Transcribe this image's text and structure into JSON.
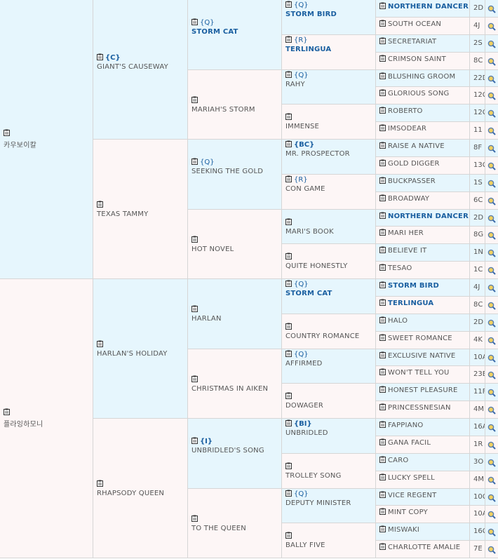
{
  "gen1": [
    {
      "name": "카우보이칼"
    },
    {
      "name": "플라잉하모니"
    }
  ],
  "gen2": [
    {
      "tag": "{C}",
      "name": "GIANT'S CAUSEWAY"
    },
    {
      "name": "TEXAS TAMMY"
    },
    {
      "name": "HARLAN'S HOLIDAY"
    },
    {
      "name": "RHAPSODY QUEEN"
    }
  ],
  "gen3": [
    {
      "tag": "{Q}",
      "name": "STORM CAT",
      "bold": true
    },
    {
      "name": "MARIAH'S STORM"
    },
    {
      "tag": "{Q}",
      "name": "SEEKING THE GOLD"
    },
    {
      "name": "HOT NOVEL"
    },
    {
      "name": "HARLAN"
    },
    {
      "name": "CHRISTMAS IN AIKEN"
    },
    {
      "tag": "{I}",
      "name": "UNBRIDLED'S SONG"
    },
    {
      "name": "TO THE QUEEN"
    }
  ],
  "gen4": [
    {
      "tag": "{Q}",
      "name": "STORM BIRD",
      "bold": true
    },
    {
      "tag": "{R}",
      "name": "TERLINGUA",
      "bold": true
    },
    {
      "tag": "{Q}",
      "name": "RAHY"
    },
    {
      "name": "IMMENSE"
    },
    {
      "tag": "{BC}",
      "name": "MR. PROSPECTOR"
    },
    {
      "tag": "{R}",
      "name": "CON GAME"
    },
    {
      "name": "MARI'S BOOK"
    },
    {
      "name": "QUITE HONESTLY"
    },
    {
      "tag": "{Q}",
      "name": "STORM CAT",
      "bold": true
    },
    {
      "name": "COUNTRY ROMANCE"
    },
    {
      "tag": "{Q}",
      "name": "AFFIRMED"
    },
    {
      "name": "DOWAGER"
    },
    {
      "tag": "{BI}",
      "name": "UNBRIDLED"
    },
    {
      "name": "TROLLEY SONG"
    },
    {
      "tag": "{Q}",
      "name": "DEPUTY MINISTER"
    },
    {
      "name": "BALLY FIVE"
    }
  ],
  "gen5": [
    {
      "name": "NORTHERN DANCER",
      "bold": true,
      "code": "2D"
    },
    {
      "name": "SOUTH OCEAN",
      "code": "4J"
    },
    {
      "name": "SECRETARIAT",
      "code": "2S"
    },
    {
      "name": "CRIMSON SAINT",
      "code": "8C"
    },
    {
      "name": "BLUSHING GROOM",
      "code": "22D"
    },
    {
      "name": "GLORIOUS SONG",
      "code": "12C"
    },
    {
      "name": "ROBERTO",
      "code": "12C"
    },
    {
      "name": "IMSODEAR",
      "code": "11"
    },
    {
      "name": "RAISE A NATIVE",
      "code": "8F"
    },
    {
      "name": "GOLD DIGGER",
      "code": "13C"
    },
    {
      "name": "BUCKPASSER",
      "code": "1S"
    },
    {
      "name": "BROADWAY",
      "code": "6C"
    },
    {
      "name": "NORTHERN DANCER",
      "bold": true,
      "code": "2D"
    },
    {
      "name": "MARI HER",
      "code": "8G"
    },
    {
      "name": "BELIEVE IT",
      "code": "1N"
    },
    {
      "name": "TESAO",
      "code": "1C"
    },
    {
      "name": "STORM BIRD",
      "bold": true,
      "code": "4J"
    },
    {
      "name": "TERLINGUA",
      "bold": true,
      "code": "8C"
    },
    {
      "name": "HALO",
      "code": "2D"
    },
    {
      "name": "SWEET ROMANCE",
      "code": "4K"
    },
    {
      "name": "EXCLUSIVE NATIVE",
      "code": "10A"
    },
    {
      "name": "WON'T TELL YOU",
      "code": "23E"
    },
    {
      "name": "HONEST PLEASURE",
      "code": "11F"
    },
    {
      "name": "PRINCESSNESIAN",
      "code": "4M"
    },
    {
      "name": "FAPPIANO",
      "code": "16A"
    },
    {
      "name": "GANA FACIL",
      "code": "1R"
    },
    {
      "name": "CARO",
      "code": "3O"
    },
    {
      "name": "LUCKY SPELL",
      "code": "4M"
    },
    {
      "name": "VICE REGENT",
      "code": "10C"
    },
    {
      "name": "MINT COPY",
      "code": "10A"
    },
    {
      "name": "MISWAKI",
      "code": "16C"
    },
    {
      "name": "CHARLOTTE AMALIE",
      "code": "7E"
    }
  ],
  "icons": {
    "clipboard": "clipboard-icon",
    "magnifier": "magnifier-icon"
  },
  "colors": {
    "blue_bg": "#e6f6fd",
    "pink_bg": "#fdf6f6",
    "bold_name": "#1a5fa0",
    "border": "#d6d6d6"
  }
}
